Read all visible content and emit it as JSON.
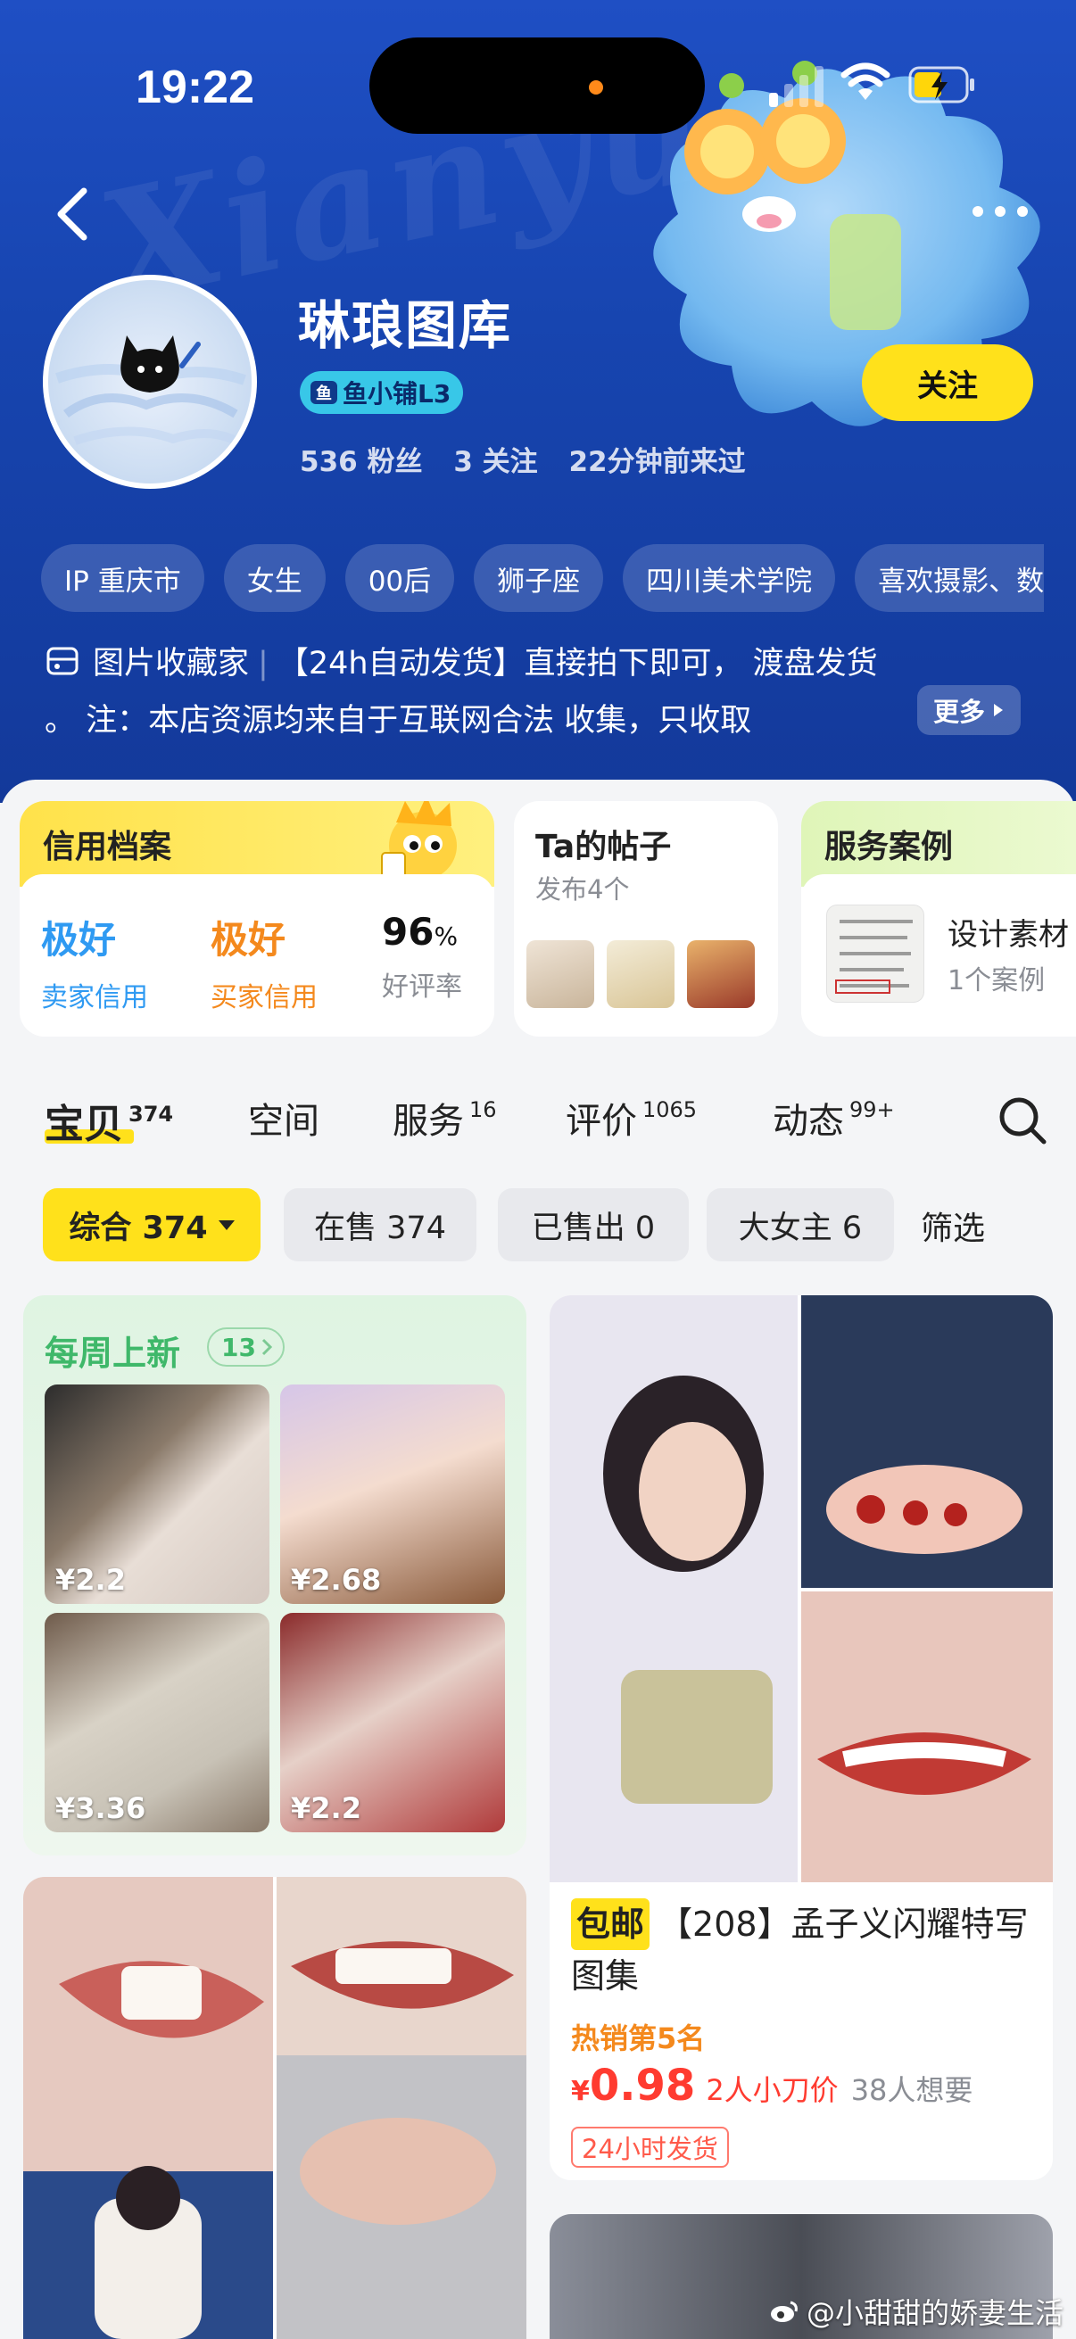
{
  "status_bar": {
    "time": "19:22"
  },
  "header": {
    "bg_text": "Xianyu",
    "shop_name": "琳琅图库",
    "level_label": "鱼小铺L3",
    "stats": [
      "536 粉丝",
      "3 关注",
      "22分钟前来过"
    ],
    "follow_label": "关注",
    "tags": [
      "IP 重庆市",
      "女生",
      "00后",
      "狮子座",
      "四川美术学院",
      "喜欢摄影、数"
    ],
    "intro_title": "图片收藏家",
    "intro_line1_rest": "【24h自动发货】直接拍下即可， 渡盘发货",
    "intro_line2": "。 注：本店资源均来自于互联网合法 收集，只收取",
    "more_label": "更多"
  },
  "credit": {
    "title": "信用档案",
    "seller_value": "极好",
    "seller_label": "卖家信用",
    "buyer_value": "极好",
    "buyer_label": "买家信用",
    "rating_value": "96",
    "rating_unit": "%",
    "rating_label": "好评率"
  },
  "posts": {
    "title": "Ta的帖子",
    "subtitle": "发布4个"
  },
  "cases": {
    "title": "服务案例",
    "item_name": "设计素材",
    "item_count": "1个案例"
  },
  "tabs": [
    {
      "label": "宝贝",
      "count": "374"
    },
    {
      "label": "空间",
      "count": ""
    },
    {
      "label": "服务",
      "count": "16"
    },
    {
      "label": "评价",
      "count": "1065"
    },
    {
      "label": "动态",
      "count": "99+"
    }
  ],
  "filters": {
    "chips": [
      "综合 374",
      "在售 374",
      "已售出 0",
      "大女主 6"
    ],
    "filter_label": "筛选"
  },
  "weekly": {
    "title": "每周上新",
    "count": "13",
    "prices": [
      "¥2.2",
      "¥2.68",
      "¥3.36",
      "¥2.2"
    ]
  },
  "product": {
    "tag": "包邮",
    "title": "【208】孟子义闪耀特写图集",
    "hot": "热销第5名",
    "yen": "¥",
    "price": "0.98",
    "cut_label": "2人小刀价",
    "want_label": "38人想要",
    "ship_label": "24小时发货"
  },
  "watermark": "@小甜甜的娇妻生活",
  "colors": {
    "brand_yellow": "#ffe11b",
    "header_blue": "#1745b0",
    "price_red": "#ff3b30",
    "credit_blue": "#2f9af2",
    "credit_orange": "#f4891d"
  }
}
